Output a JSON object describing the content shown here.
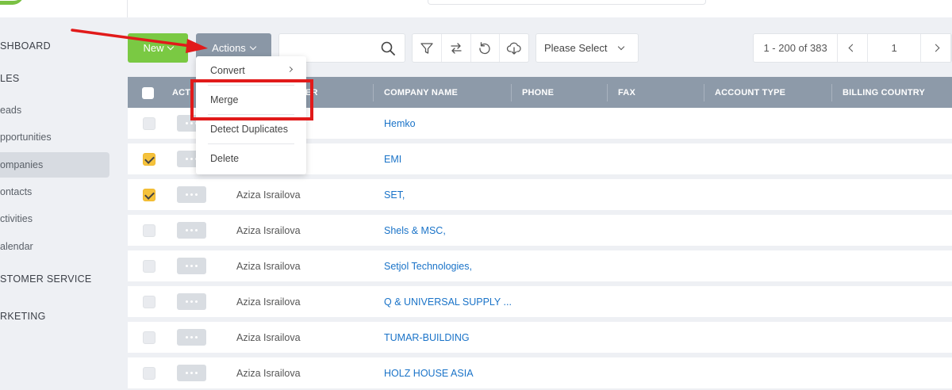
{
  "sidebar": {
    "items": [
      {
        "label": "SHBOARD"
      },
      {
        "label": "LES"
      },
      {
        "label": "eads"
      },
      {
        "label": "pportunities"
      },
      {
        "label": "ompanies"
      },
      {
        "label": "ontacts"
      },
      {
        "label": "ctivities"
      },
      {
        "label": "alendar"
      },
      {
        "label": "STOMER SERVICE"
      },
      {
        "label": "RKETING"
      }
    ]
  },
  "toolbar": {
    "new_label": "New",
    "actions_label": "Actions",
    "search_placeholder": "",
    "select_label": "Please Select"
  },
  "pager": {
    "range": "1 - 200 of 383",
    "page": "1"
  },
  "actions_menu": {
    "items": [
      {
        "label": "Convert"
      },
      {
        "label": "Merge"
      },
      {
        "label": "Detect Duplicates"
      },
      {
        "label": "Delete"
      }
    ]
  },
  "table": {
    "columns": [
      "ACT",
      "ER",
      "COMPANY NAME",
      "PHONE",
      "FAX",
      "ACCOUNT TYPE",
      "BILLING COUNTRY"
    ],
    "rows": [
      {
        "checked": false,
        "owner": "",
        "company": "Hemko"
      },
      {
        "checked": true,
        "owner": "",
        "company": "EMI"
      },
      {
        "checked": true,
        "owner": "Aziza Israilova",
        "company": "SET,"
      },
      {
        "checked": false,
        "owner": "Aziza Israilova",
        "company": "Shels & MSC,"
      },
      {
        "checked": false,
        "owner": "Aziza Israilova",
        "company": "Setjol Technologies,"
      },
      {
        "checked": false,
        "owner": "Aziza Israilova",
        "company": "Q & UNIVERSAL SUPPLY ..."
      },
      {
        "checked": false,
        "owner": "Aziza Israilova",
        "company": "TUMAR-BUILDING"
      },
      {
        "checked": false,
        "owner": "Aziza Israilova",
        "company": "HOLZ HOUSE ASIA"
      }
    ]
  },
  "colors": {
    "new_button": "#7ac943",
    "actions_button": "#8a97a6",
    "header_bg": "#8d9aa9",
    "link": "#1a73c8",
    "check": "#f5c23c",
    "annotation": "#e11a1a"
  }
}
